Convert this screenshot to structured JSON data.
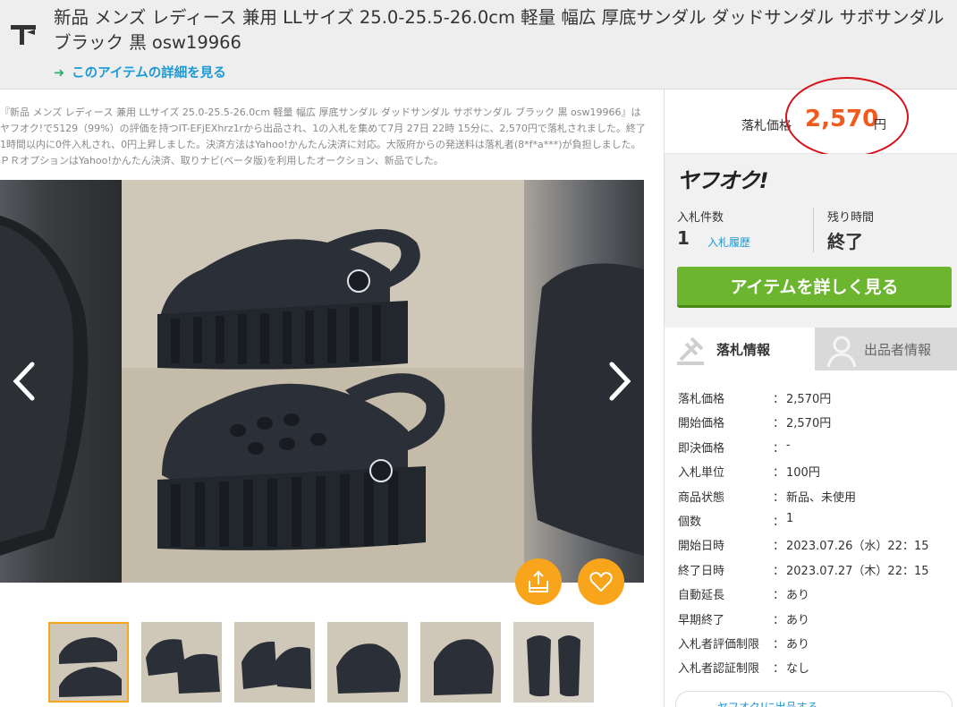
{
  "header": {
    "title": "新品 メンズ レディース 兼用 LLサイズ 25.0-25.5-26.0cm 軽量 幅広 厚底サンダル ダッドサンダル サボサンダル ブラック 黒 osw19966",
    "detail_link": "このアイテムの詳細を見る"
  },
  "description": "『新品 メンズ レディース 兼用 LLサイズ 25.0-25.5-26.0cm 軽量 幅広 厚底サンダル ダッドサンダル サボサンダル ブラック 黒 osw19966』はヤフオク!で5129（99%）の評価を持つIT-EFjEXhrz1rから出品され、1の入札を集めて7月 27日 22時 15分に、2,570円で落札されました。終了1時間以内に0件入札され、0円上昇しました。決済方法はYahoo!かんたん決済に対応。大阪府からの発送料は落札者(8*f*a***)が負担しました。ＰＲオプションはYahoo!かんたん決済、取りナビ(ベータ版)を利用したオークション、新品でした。",
  "price": {
    "label": "落札価格",
    "value": "2,570",
    "unit": "円",
    "color": "#f05a1e"
  },
  "auction_box": {
    "logo": "ヤフオク!",
    "bids_label": "入札件数",
    "bids_count": "1",
    "bid_history": "入札履歴",
    "remaining_label": "残り時間",
    "remaining_value": "終了",
    "detail_button": "アイテムを詳しく見る"
  },
  "tabs": [
    {
      "label": "落札情報",
      "active": true
    },
    {
      "label": "出品者情報",
      "active": false
    }
  ],
  "info_rows": [
    {
      "key": "落札価格",
      "value": "2,570円"
    },
    {
      "key": "開始価格",
      "value": "2,570円"
    },
    {
      "key": "即決価格",
      "value": "-"
    },
    {
      "key": "入札単位",
      "value": "100円"
    },
    {
      "key": "商品状態",
      "value": "新品、未使用"
    },
    {
      "key": "個数",
      "value": "1"
    },
    {
      "key": "開始日時",
      "value": "2023.07.26（水）22：15"
    },
    {
      "key": "終了日時",
      "value": "2023.07.27（木）22：15"
    },
    {
      "key": "自動延長",
      "value": "あり"
    },
    {
      "key": "早期終了",
      "value": "あり"
    },
    {
      "key": "入札者評価制限",
      "value": "あり"
    },
    {
      "key": "入札者認証制限",
      "value": "なし"
    }
  ],
  "info_colon": "：",
  "bottom_link": "ヤフオク!に出品する",
  "colors": {
    "accent_green": "#6cb52f",
    "link_blue": "#1a9ad6",
    "orange_button": "#f9a51b",
    "highlight_circle": "#d8121a"
  }
}
